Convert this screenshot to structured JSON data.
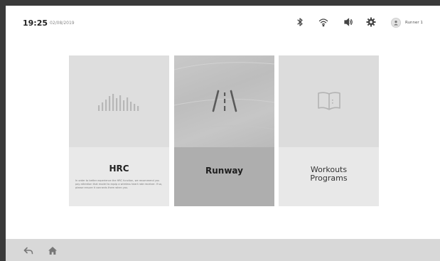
{
  "status_bar": {
    "time": "19:25",
    "date": "02/08/2019",
    "user_name": "Runner 1"
  },
  "cards": [
    {
      "title": "HRC",
      "icon": "equalizer-bars-icon",
      "description": "In order to better experience the HRC function, we recommend you pay attention that model to equip a wireless heart rate receiver. If so, please ensure it connects them when you."
    },
    {
      "title": "Runway",
      "icon": "road-icon",
      "selected": true
    },
    {
      "title_line1": "Workouts",
      "title_line2": "Programs",
      "icon": "open-book-icon"
    }
  ],
  "footer": {
    "icons": [
      "back-arrow-icon",
      "home-icon"
    ]
  },
  "colors": {
    "background": "#ffffff",
    "bezel": "#3a3a3a",
    "footer": "#d8d8d8",
    "selected_card": "#aeaeae"
  }
}
